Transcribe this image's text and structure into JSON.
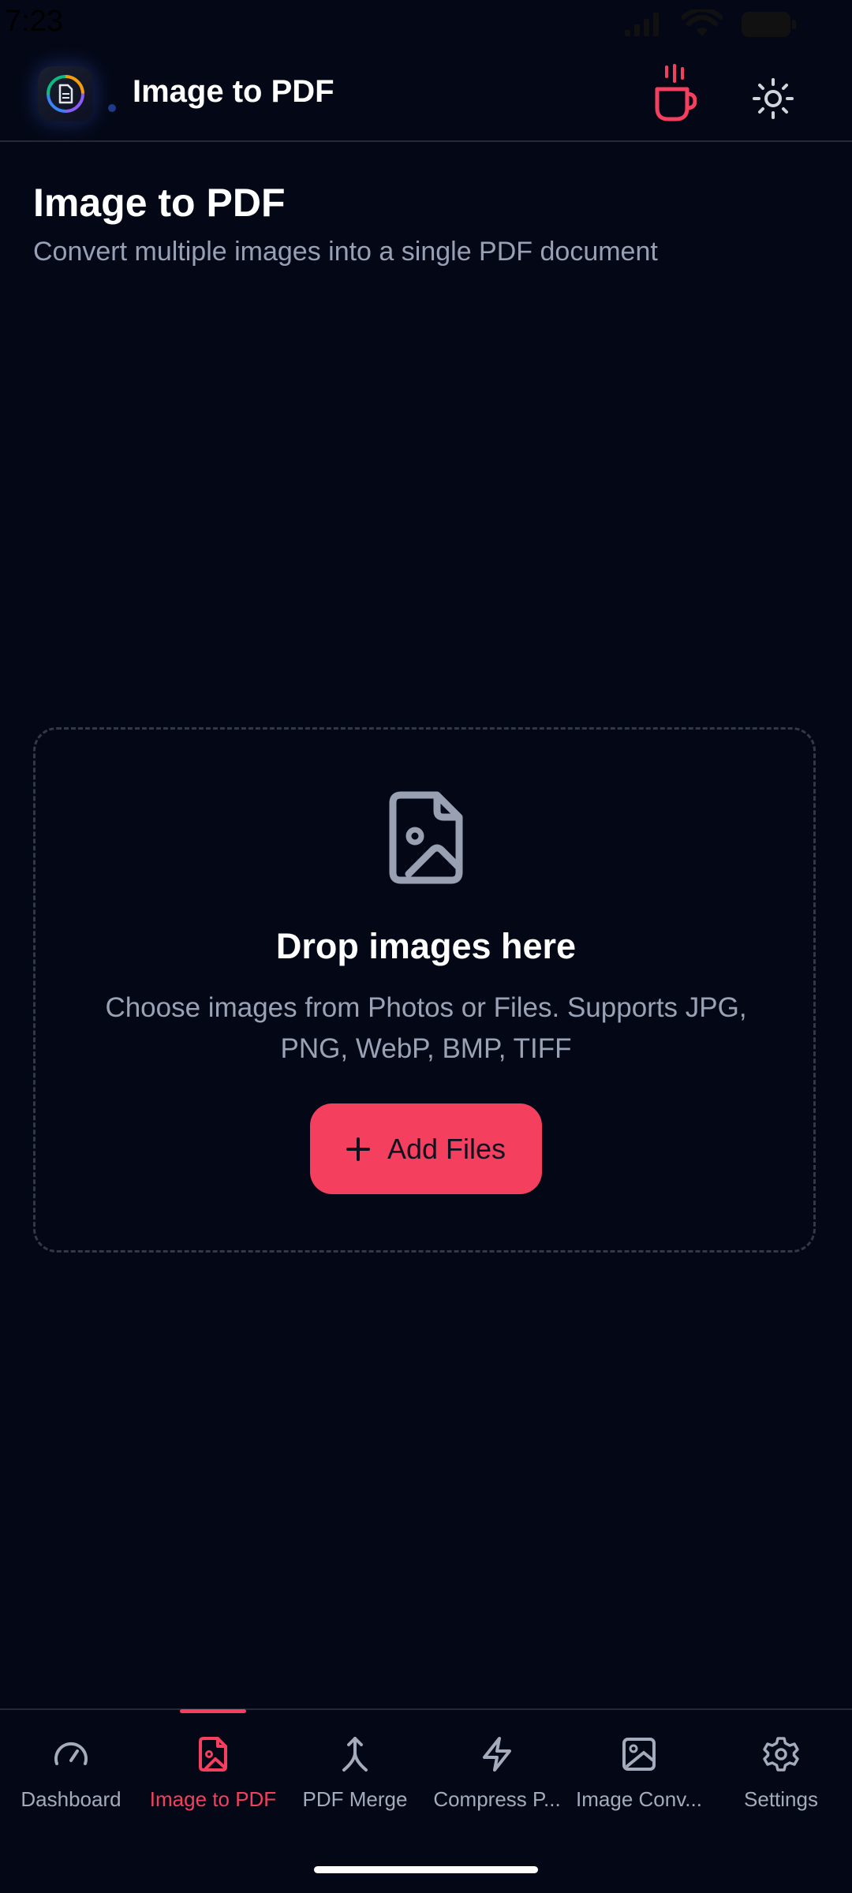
{
  "status_bar": {
    "time": "7:23",
    "icons": [
      "signal-icon",
      "wifi-icon",
      "battery-icon"
    ]
  },
  "header": {
    "title": "Image to PDF",
    "actions": [
      "coffee-icon",
      "sun-icon"
    ]
  },
  "page": {
    "title": "Image to PDF",
    "subtitle": "Convert multiple images into a single PDF document"
  },
  "drop_zone": {
    "icon": "file-image-icon",
    "title": "Drop images here",
    "description": "Choose images from Photos or Files. Supports JPG, PNG, WebP, BMP, TIFF",
    "button_label": "Add Files",
    "button_icon": "plus-icon"
  },
  "bottom_nav": {
    "items": [
      {
        "label": "Dashboard",
        "icon": "gauge-icon",
        "active": false
      },
      {
        "label": "Image to PDF",
        "icon": "file-image-icon",
        "active": true
      },
      {
        "label": "PDF Merge",
        "icon": "merge-icon",
        "active": false
      },
      {
        "label": "Compress P...",
        "icon": "bolt-icon",
        "active": false
      },
      {
        "label": "Image Conv...",
        "icon": "image-icon",
        "active": false
      },
      {
        "label": "Settings",
        "icon": "gear-icon",
        "active": false
      }
    ]
  },
  "colors": {
    "background": "#040816",
    "accent": "#f43f5e",
    "muted_text": "#9aa2b5",
    "border": "#30384a"
  }
}
